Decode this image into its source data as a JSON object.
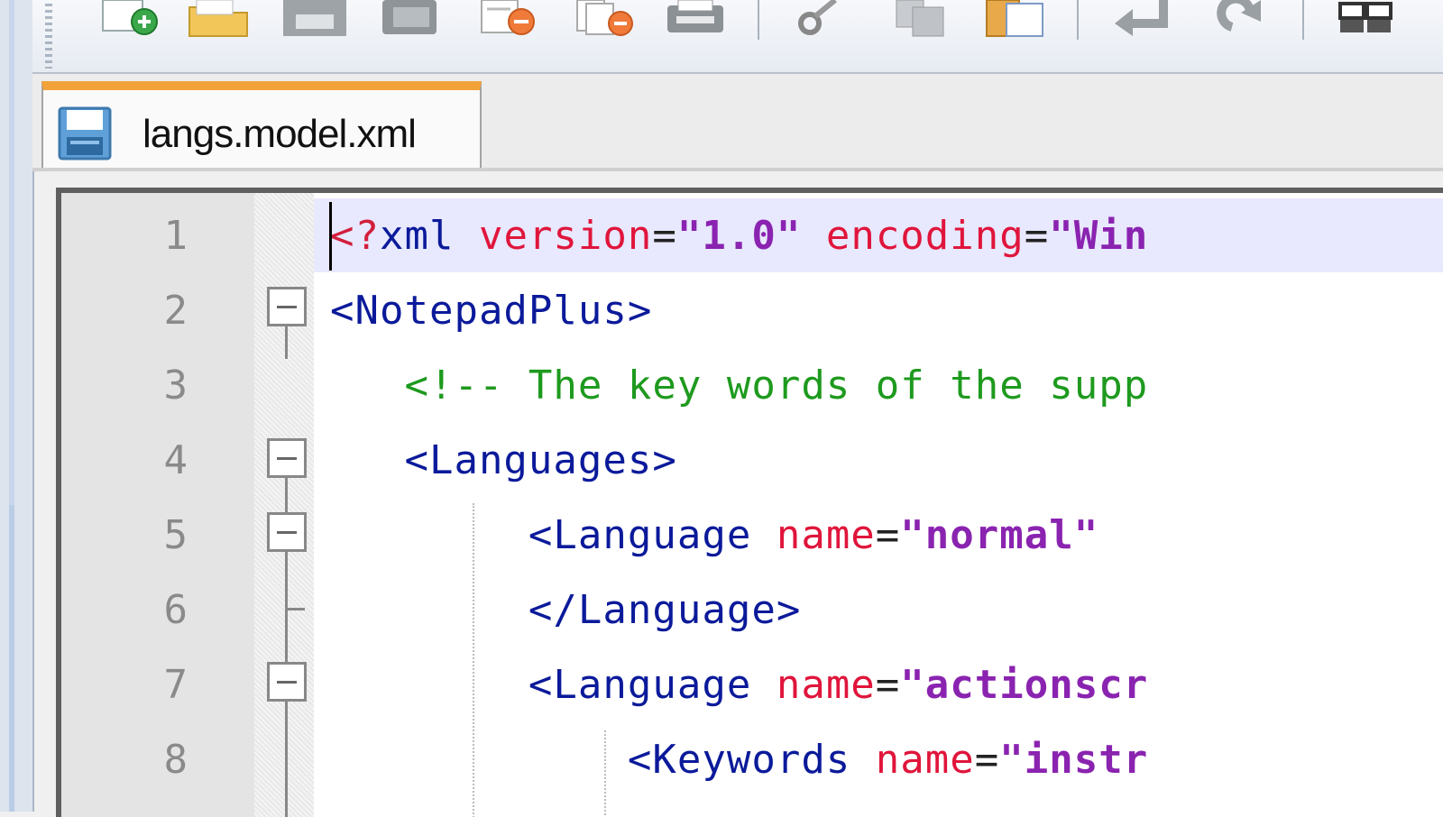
{
  "window": {
    "accent_color": "#f1a33a"
  },
  "toolbar": {
    "buttons": [
      {
        "icon": "new-file-icon"
      },
      {
        "icon": "open-folder-icon"
      },
      {
        "icon": "save-icon"
      },
      {
        "icon": "save-all-icon"
      },
      {
        "icon": "close-icon"
      },
      {
        "icon": "close-all-icon"
      },
      {
        "icon": "print-icon"
      },
      {
        "icon": "cut-icon"
      },
      {
        "icon": "copy-icon"
      },
      {
        "icon": "paste-icon"
      },
      {
        "icon": "undo-icon"
      },
      {
        "icon": "redo-icon"
      },
      {
        "icon": "view-icon"
      }
    ]
  },
  "tabs": [
    {
      "label": "langs.model.xml",
      "icon": "floppy-save-icon",
      "active": true
    }
  ],
  "editor": {
    "lines": [
      {
        "number": "1",
        "tokens": [
          {
            "t": "<?",
            "c": "t-pi"
          },
          {
            "t": "xml",
            "c": "t-tag"
          },
          {
            "t": " version",
            "c": "t-attr"
          },
          {
            "t": "=",
            "c": "t-eq"
          },
          {
            "t": "\"1.0\"",
            "c": "t-val"
          },
          {
            "t": " encoding",
            "c": "t-attr"
          },
          {
            "t": "=",
            "c": "t-eq"
          },
          {
            "t": "\"Win",
            "c": "t-val"
          }
        ]
      },
      {
        "number": "2",
        "tokens": [
          {
            "t": "<NotepadPlus>",
            "c": "t-tag"
          }
        ]
      },
      {
        "number": "3",
        "tokens": [
          {
            "t": "   <!-- The key words of the supp",
            "c": "t-comment"
          }
        ]
      },
      {
        "number": "4",
        "tokens": [
          {
            "t": "   <Languages>",
            "c": "t-tag"
          }
        ]
      },
      {
        "number": "5",
        "tokens": [
          {
            "t": "        <Language",
            "c": "t-tag"
          },
          {
            "t": " name",
            "c": "t-attr"
          },
          {
            "t": "=",
            "c": "t-eq"
          },
          {
            "t": "\"normal\"",
            "c": "t-val"
          }
        ]
      },
      {
        "number": "6",
        "tokens": [
          {
            "t": "        </Language>",
            "c": "t-tag"
          }
        ]
      },
      {
        "number": "7",
        "tokens": [
          {
            "t": "        <Language",
            "c": "t-tag"
          },
          {
            "t": " name",
            "c": "t-attr"
          },
          {
            "t": "=",
            "c": "t-eq"
          },
          {
            "t": "\"actionscr",
            "c": "t-val"
          }
        ]
      },
      {
        "number": "8",
        "tokens": [
          {
            "t": "            <Keywords",
            "c": "t-tag"
          },
          {
            "t": " name",
            "c": "t-attr"
          },
          {
            "t": "=",
            "c": "t-eq"
          },
          {
            "t": "\"instr",
            "c": "t-val"
          }
        ]
      }
    ]
  }
}
